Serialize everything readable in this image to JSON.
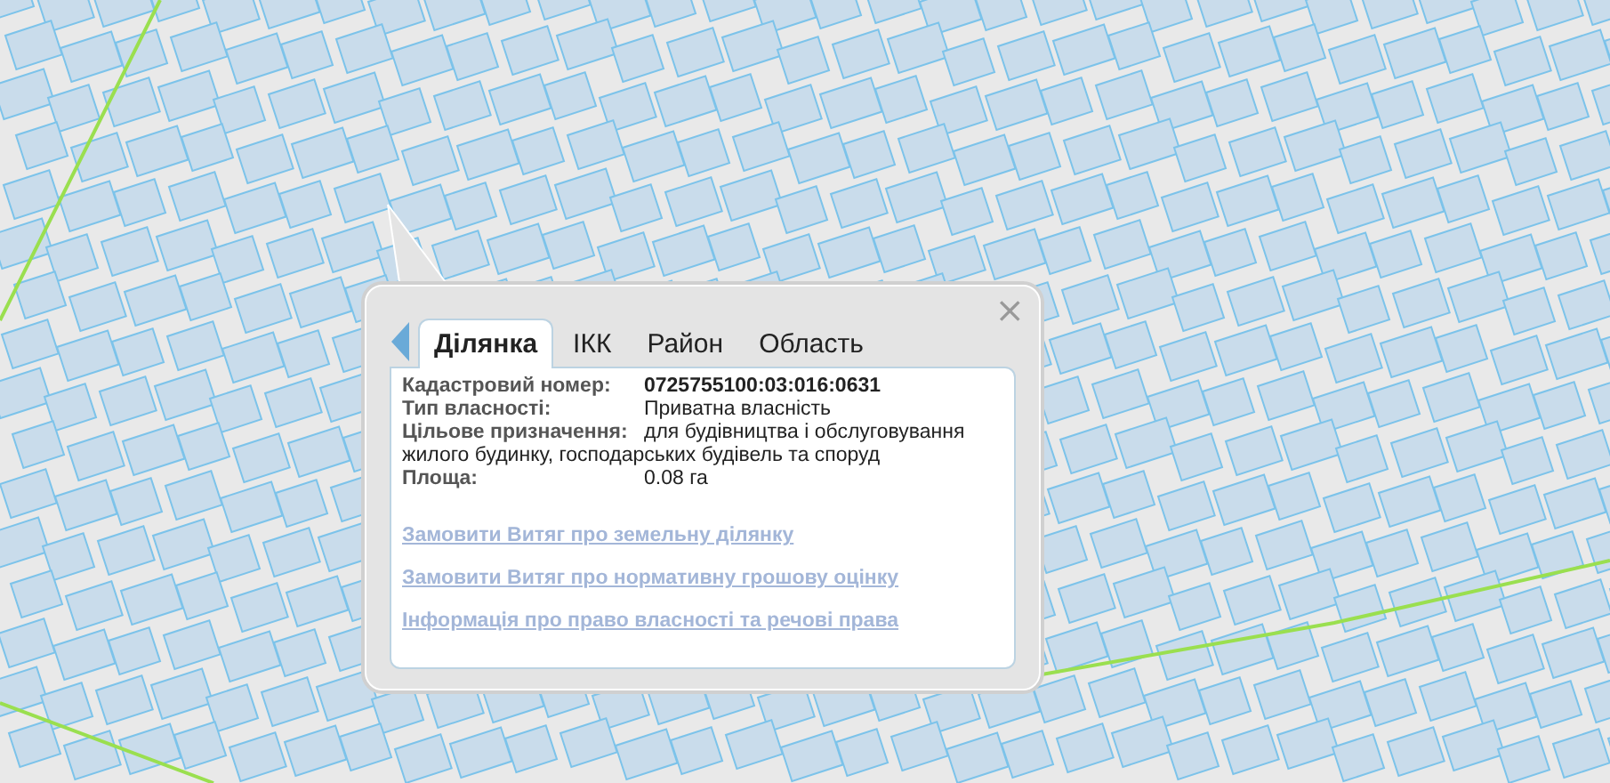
{
  "popup": {
    "close": "×",
    "tabs": [
      {
        "label": "Ділянка",
        "selected": true
      },
      {
        "label": "ІКК",
        "selected": false
      },
      {
        "label": "Район",
        "selected": false
      },
      {
        "label": "Область",
        "selected": false
      }
    ],
    "fields": [
      {
        "label": "Кадастровий номер:",
        "value": "0725755100:03:016:0631",
        "bold": true
      },
      {
        "label": "Тип власності:",
        "value": "Приватна власність",
        "bold": false
      },
      {
        "label": "Цільове призначення:",
        "value": "для будівництва і обслуговування жилого будинку, господарських будівель та споруд",
        "bold": false
      },
      {
        "label": "Площа:",
        "value": "0.08 га",
        "bold": false
      }
    ],
    "links": [
      "Замовити Витяг про земельну ділянку",
      "Замовити Витяг про нормативну грошову оцінку",
      "Інформація про право власності та речові права"
    ]
  }
}
